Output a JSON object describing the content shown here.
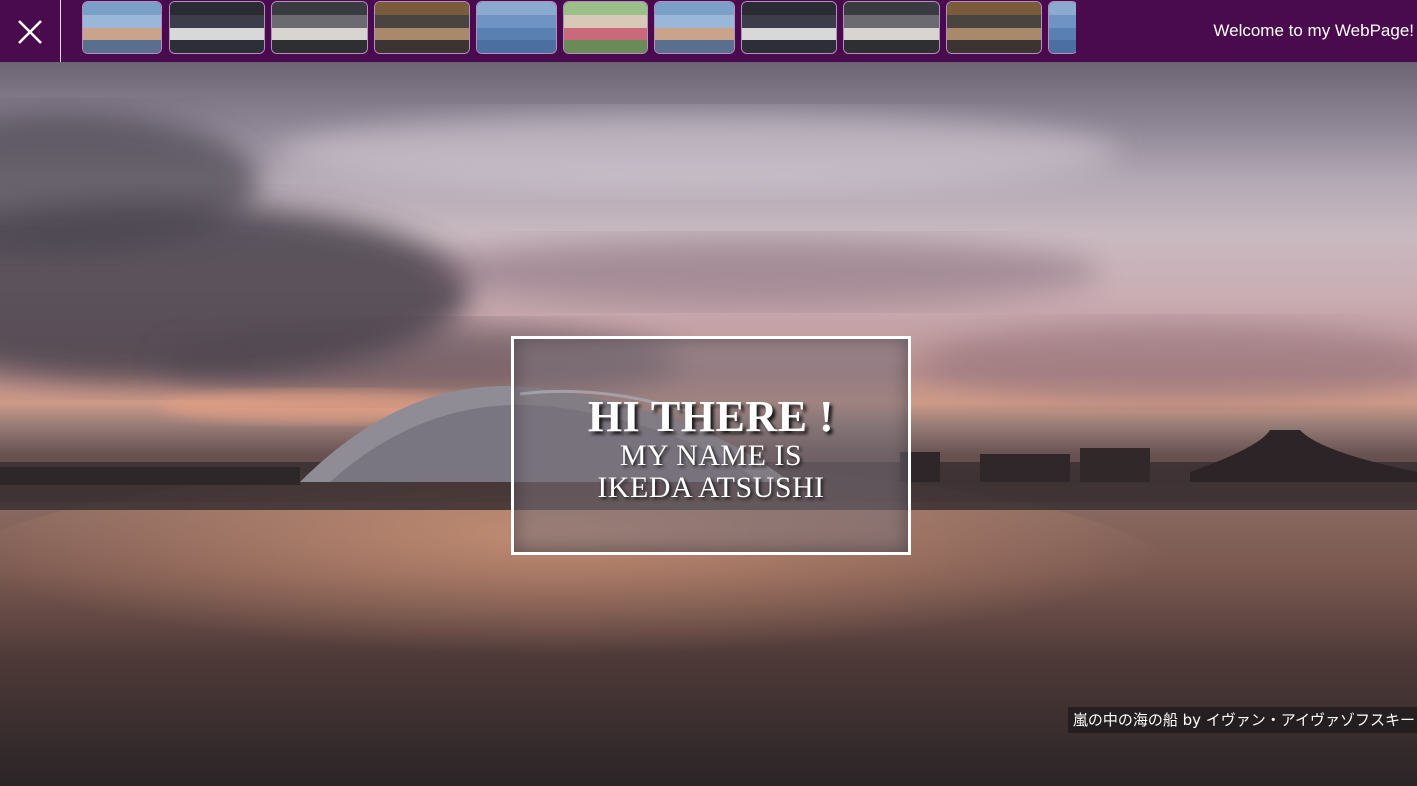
{
  "header": {
    "close_icon": "close-x-icon",
    "welcome_text": "Welcome to my WebPage!",
    "background_color": "#4a0a4e",
    "thumbnails": [
      {
        "subject": "group-photo",
        "colors": [
          "#7aa0c8",
          "#9ab7d8",
          "#c9a38a",
          "#5a6f8e"
        ]
      },
      {
        "subject": "presenter-at-laptop",
        "colors": [
          "#2a2b33",
          "#3b3e4a",
          "#d8d8d8",
          "#2d2f38"
        ]
      },
      {
        "subject": "presenter-at-laptop",
        "colors": [
          "#3a3b40",
          "#6b6a70",
          "#d8d4d0",
          "#2e2f33"
        ]
      },
      {
        "subject": "person-in-library",
        "colors": [
          "#7a5c3c",
          "#4a4440",
          "#a88a6a",
          "#3c3430"
        ]
      },
      {
        "subject": "swimming-in-sea",
        "colors": [
          "#8aaad0",
          "#6f93c2",
          "#5a80b2",
          "#4a6fa0"
        ]
      },
      {
        "subject": "two-people-outdoors",
        "colors": [
          "#9abf88",
          "#d8c8b8",
          "#c86a7a",
          "#6a8a58"
        ]
      },
      {
        "subject": "group-photo",
        "colors": [
          "#7aa0c8",
          "#9ab7d8",
          "#c9a38a",
          "#5a6f8e"
        ]
      },
      {
        "subject": "presenter-at-laptop",
        "colors": [
          "#2a2b33",
          "#3b3e4a",
          "#d8d8d8",
          "#2d2f38"
        ]
      },
      {
        "subject": "presenter-at-laptop",
        "colors": [
          "#3a3b40",
          "#6b6a70",
          "#d8d4d0",
          "#2e2f33"
        ]
      },
      {
        "subject": "person-in-library",
        "colors": [
          "#7a5c3c",
          "#4a4440",
          "#a88a6a",
          "#3c3430"
        ]
      },
      {
        "subject": "swimming-in-sea",
        "colors": [
          "#8aaad0",
          "#6f93c2",
          "#5a80b2",
          "#4a6fa0"
        ]
      }
    ]
  },
  "hero": {
    "background_subject": "sunset-over-lake-with-stadium",
    "card": {
      "title": "HI THERE !",
      "line1": "MY NAME IS",
      "line2": "IKEDA ATSUSHI"
    },
    "caption": "嵐の中の海の船 by イヴァン・アイヴァゾフスキー"
  }
}
